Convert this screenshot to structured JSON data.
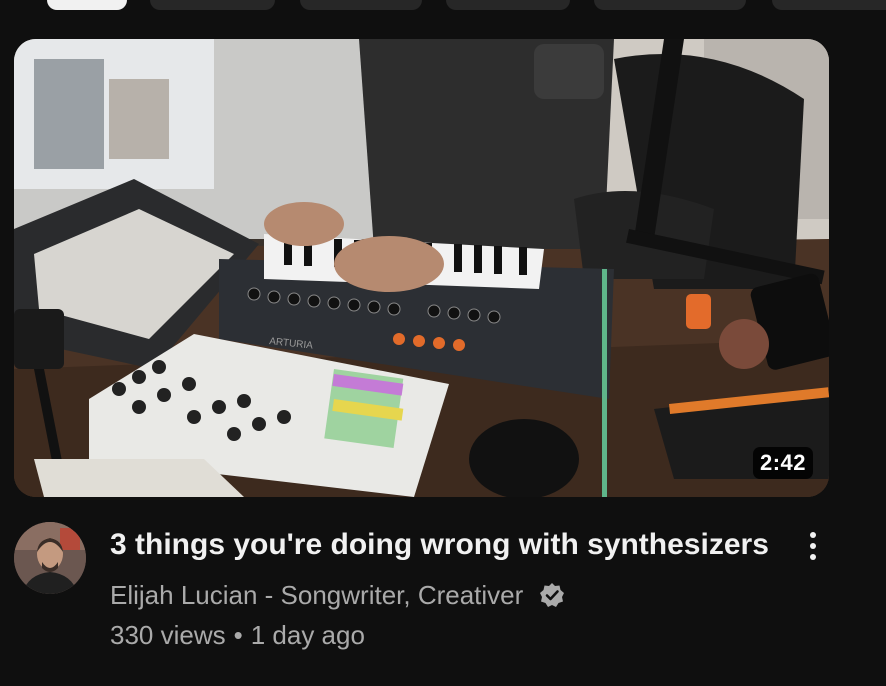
{
  "video": {
    "duration": "2:42",
    "title": "3 things you're doing wrong with synthesizers",
    "channel": "Elijah Lucian - Songwriter, Creativer",
    "views": "330 views",
    "separator": "•",
    "uploaded": "1 day ago"
  },
  "thumbnail": {
    "brand_text": "ARTURIA"
  },
  "icons": {
    "verified": "verified-badge-icon",
    "more": "more-vertical-icon"
  },
  "colors": {
    "background": "#0f0f0f",
    "title": "#f1f1f1",
    "secondary": "#aaaaaa",
    "chip": "#272727",
    "chip_active": "#f1f1f1"
  }
}
